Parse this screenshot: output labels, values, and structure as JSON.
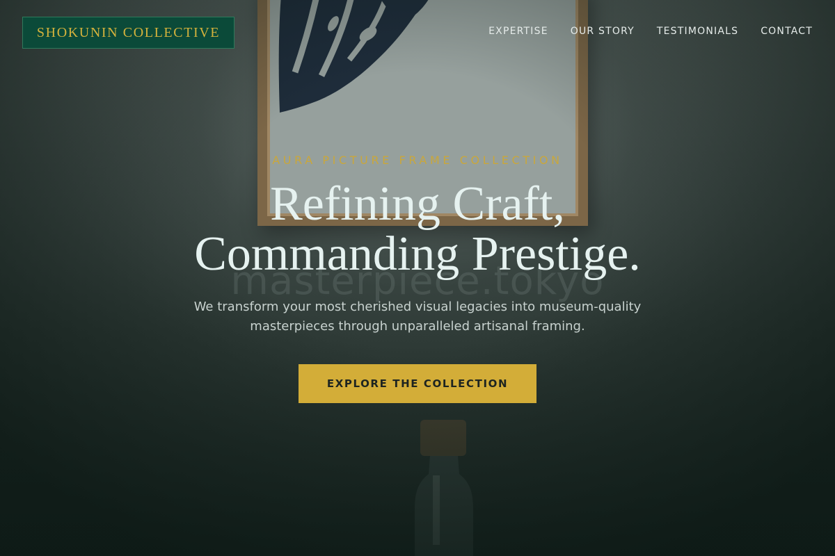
{
  "brand": {
    "name": "SHOKUNIN COLLECTIVE"
  },
  "nav": {
    "items": [
      {
        "label": "EXPERTISE"
      },
      {
        "label": "OUR STORY"
      },
      {
        "label": "TESTIMONIALS"
      },
      {
        "label": "CONTACT"
      }
    ]
  },
  "hero": {
    "eyebrow": "AURA PICTURE FRAME COLLECTION",
    "headline_line1": "Refining Craft,",
    "headline_line2": "Commanding Prestige.",
    "watermark": "masterpiece.tokyo",
    "subtitle": "We transform your most cherished visual legacies into museum-quality masterpieces through unparalleled artisanal framing.",
    "cta_label": "EXPLORE THE COLLECTION"
  },
  "colors": {
    "brand_green": "#0b4a39",
    "accent_gold": "#d3ad38",
    "headline": "#e6f2f0"
  }
}
